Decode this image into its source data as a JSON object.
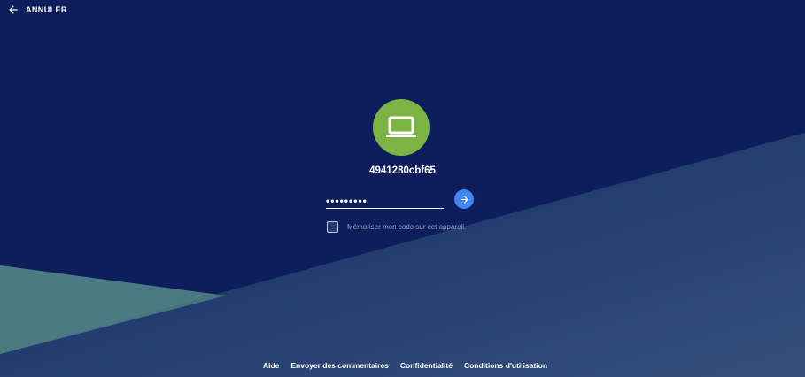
{
  "header": {
    "cancel_label": "ANNULER",
    "cancel_icon": "arrow-left-icon"
  },
  "login": {
    "avatar_icon": "laptop-icon",
    "avatar_color": "#7cb342",
    "device_name": "4941280cbf65",
    "pin_value": "•••••••••",
    "submit_icon": "arrow-right-icon",
    "submit_color": "#4285f4",
    "remember_label": "Mémoriser mon code sur cet appareil.",
    "remember_checked": false
  },
  "footer": {
    "links": [
      "Aide",
      "Envoyer des commentaires",
      "Confidentialité",
      "Conditions d'utilisation"
    ]
  },
  "colors": {
    "background_top": "#0e1e5c",
    "background_bottom": "#2e4a72",
    "accent_teal": "#4f7e83"
  }
}
